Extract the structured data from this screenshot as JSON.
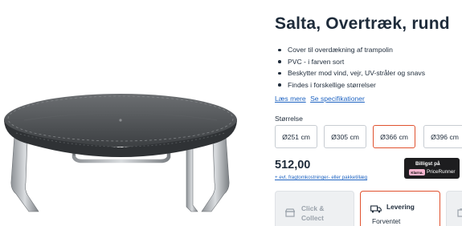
{
  "product": {
    "title": "Salta, Overtræk, rund",
    "image_alt": "trampoline-with-cover"
  },
  "bullets": [
    "Cover til overdækning af trampolin",
    "PVC - i farven sort",
    "Beskytter mod vind, vejr, UV-stråler og snavs",
    "Findes i forskellige størrelser"
  ],
  "links": {
    "read_more": "Læs mere",
    "specs": "Se specifikationer"
  },
  "size": {
    "label": "Størrelse",
    "options": [
      "Ø251 cm",
      "Ø305 cm",
      "Ø366 cm",
      "Ø396 cm"
    ],
    "selected": "Ø366 cm"
  },
  "price": {
    "value": "512,00",
    "shipping_note": "+ evt. fragtomkostninger- eller pakketillæg"
  },
  "pricerunner": {
    "top": "Billigst på",
    "klarna": "Klarna.",
    "name": "PriceRunner"
  },
  "delivery": {
    "click_collect": "Click & Collect",
    "levering": "Levering",
    "levering_sub": "Forventet"
  },
  "colors": {
    "accent": "#e0522f",
    "link": "#2266c3",
    "text": "#1e2b3a"
  }
}
